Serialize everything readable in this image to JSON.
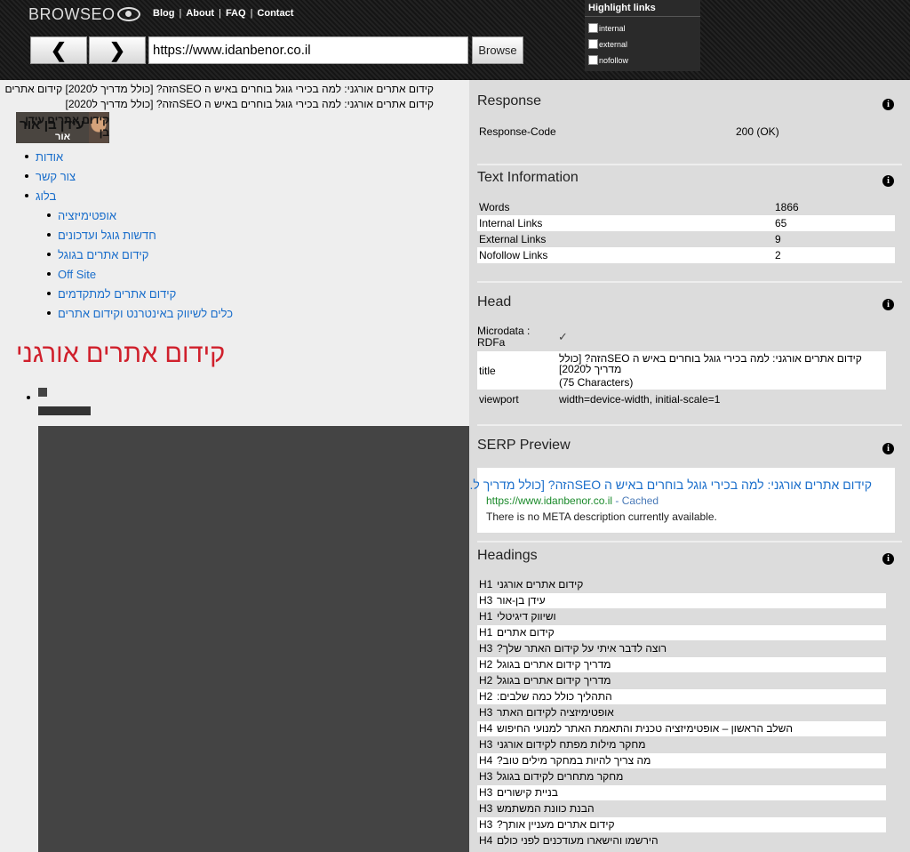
{
  "header": {
    "logo": "BROWSEO",
    "nav": [
      "Blog",
      "About",
      "FAQ",
      "Contact"
    ],
    "back_label": "❮",
    "forward_label": "❯",
    "url": "https://www.idanbenor.co.il",
    "browse_label": "Browse",
    "highlight": {
      "title": "Highlight links",
      "options": [
        "internal",
        "external",
        "nofollow"
      ]
    }
  },
  "left": {
    "title_line1": "קידום אתרים אורגני: למה בכירי גוגל בוחרים באיש ה SEOהזה? [כולל מדריך ל2020] קידום אתרים",
    "title_line2": "קידום אתרים אורגני: למה בכירי גוגל בוחרים באיש ה SEOהזה? [כולל מדריך ל2020]",
    "logo_text1": "קידום אתרים עידן בן",
    "logo_text2": "עידן בן אור",
    "logo_text3": "אור",
    "menu": [
      "אודות",
      "צור קשר",
      "בלוג"
    ],
    "submenu": [
      "אופטימיזציה",
      "חדשות גוגל ועדכונים",
      "קידום אתרים בגוגל",
      "Off Site",
      "קידום אתרים למתקדמים",
      "כלים לשיווק באינטרנט וקידום אתרים"
    ],
    "h1": "קידום אתרים אורגני"
  },
  "right": {
    "response": {
      "title": "Response",
      "label": "Response-Code",
      "value": "200 (OK)"
    },
    "text_info": {
      "title": "Text Information",
      "rows": [
        {
          "label": "Words",
          "value": "1866"
        },
        {
          "label": "Internal Links",
          "value": "65"
        },
        {
          "label": "External Links",
          "value": "9"
        },
        {
          "label": "Nofollow Links",
          "value": "2"
        }
      ]
    },
    "head": {
      "title": "Head",
      "microdata_label": "Microdata : RDFa",
      "microdata_value": "✓",
      "title_label": "title",
      "title_value": "קידום אתרים אורגני: למה בכירי גוגל בוחרים באיש ה SEOהזה? [כולל מדריך ל2020]",
      "title_chars": "(75 Characters)",
      "viewport_label": "viewport",
      "viewport_value": "width=device-width, initial-scale=1"
    },
    "serp": {
      "title": "SERP Preview",
      "link": "קידום אתרים אורגני: למה בכירי גוגל בוחרים באיש ה SEOהזה? [כולל מדריך ל...",
      "url": "https://www.idanbenor.co.il",
      "cached": " - Cached",
      "desc": "There is no META description currently available."
    },
    "headings": {
      "title": "Headings",
      "rows": [
        {
          "level": "H1",
          "text": "קידום אתרים אורגני"
        },
        {
          "level": "H3",
          "text": "עידן בן-אור"
        },
        {
          "level": "H1",
          "text": "ושיווק דיגיטלי"
        },
        {
          "level": "H1",
          "text": "קידום אתרים"
        },
        {
          "level": "H3",
          "text": "רוצה לדבר איתי על קידום האתר שלך?"
        },
        {
          "level": "H2",
          "text": "מדריך קידום אתרים בגוגל"
        },
        {
          "level": "H2",
          "text": "מדריך קידום אתרים בגוגל"
        },
        {
          "level": "H2",
          "text": "התהליך כולל כמה שלבים:"
        },
        {
          "level": "H3",
          "text": "אופטימיזציה לקידום האתר"
        },
        {
          "level": "H4",
          "text": "השלב הראשון – אופטימיזציה טכנית והתאמת האתר למנועי החיפוש"
        },
        {
          "level": "H3",
          "text": "מחקר מילות מפתח לקידום אורגני"
        },
        {
          "level": "H4",
          "text": "מה צריך להיות במחקר מילים טוב?"
        },
        {
          "level": "H3",
          "text": "מחקר מתחרים לקידום בגוגל"
        },
        {
          "level": "H3",
          "text": "בניית קישורים"
        },
        {
          "level": "H3",
          "text": "הבנת כוונת המשתמש"
        },
        {
          "level": "H3",
          "text": "קידום אתרים מעניין אותך?"
        },
        {
          "level": "H4",
          "text": "הירשמו והישארו מעודכנים לפני כולם"
        }
      ]
    }
  }
}
